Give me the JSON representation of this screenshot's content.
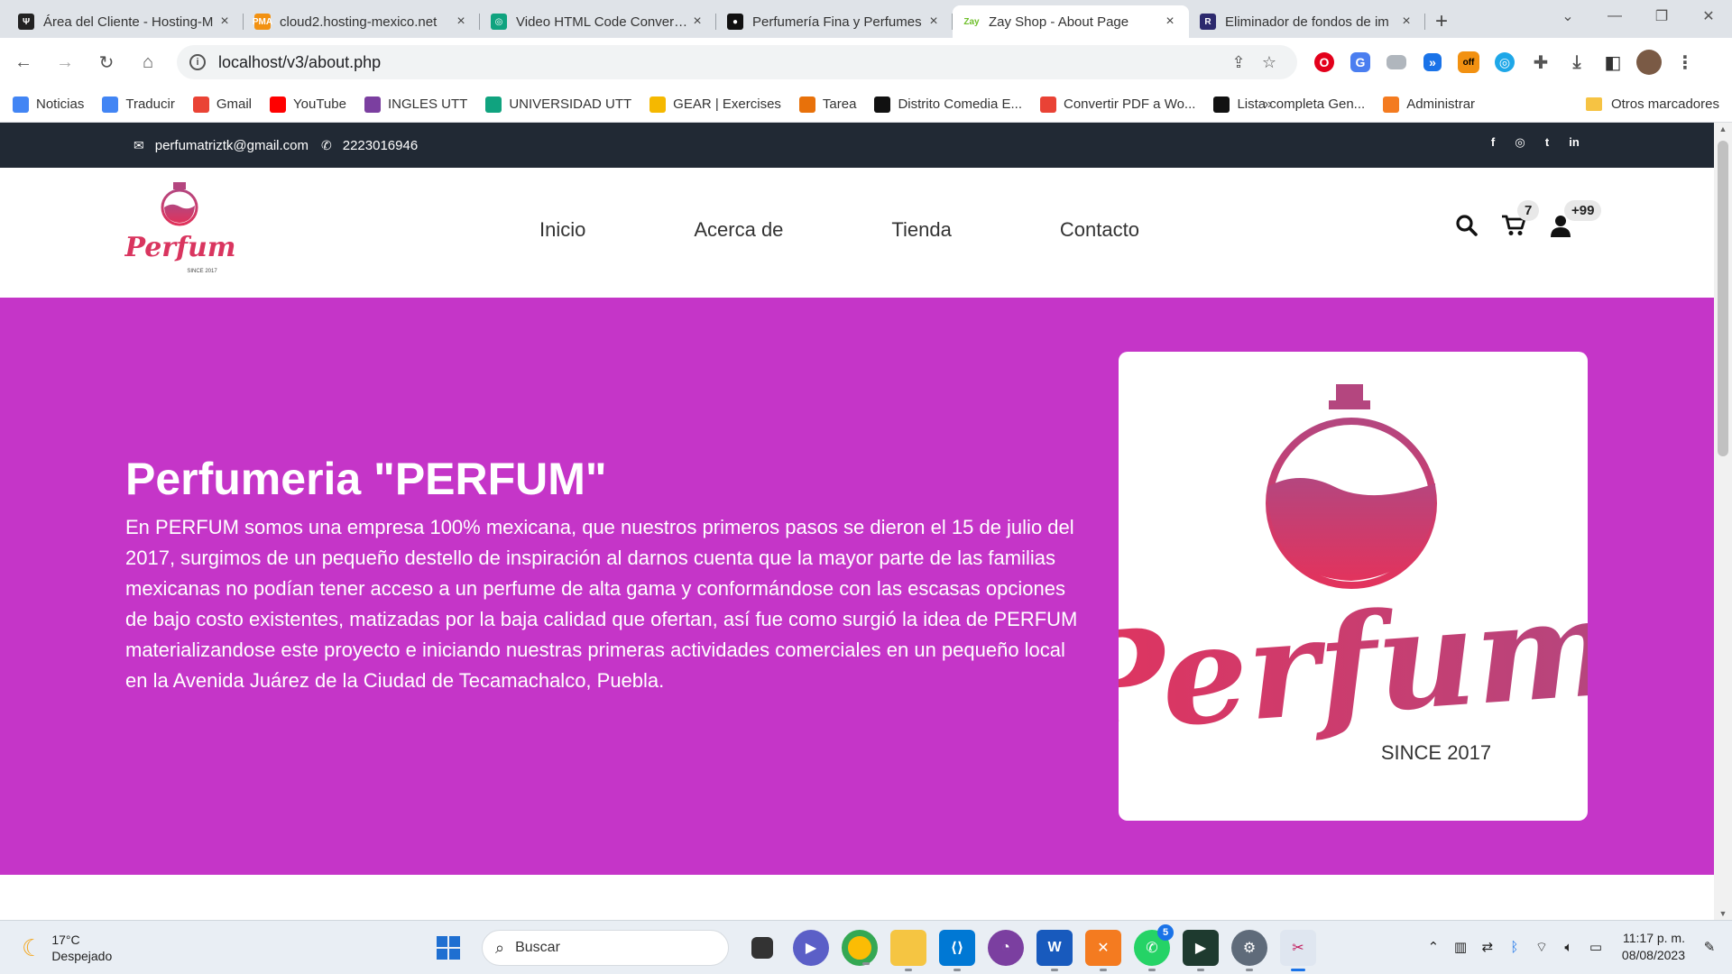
{
  "browser": {
    "tabs": [
      {
        "title": "Área del Cliente - Hosting-M",
        "fav_color": "#222222",
        "fav_glyph": "Ψ"
      },
      {
        "title": "cloud2.hosting-mexico.net",
        "fav_color": "#f29111",
        "fav_glyph": "PMA"
      },
      {
        "title": "Video HTML Code Conversion",
        "fav_color": "#10a37f",
        "fav_glyph": "◎"
      },
      {
        "title": "Perfumería Fina y Perfumes",
        "fav_color": "#111111",
        "fav_glyph": "●"
      },
      {
        "title": "Zay Shop - About Page",
        "fav_color": "#ffffff",
        "fav_glyph": "Zay",
        "active": true
      },
      {
        "title": "Eliminador de fondos de im",
        "fav_color": "#2d2a6e",
        "fav_glyph": "R"
      }
    ],
    "url": "localhost/v3/about.php",
    "bookmarks": [
      {
        "label": "Noticias",
        "color": "#4285f4"
      },
      {
        "label": "Traducir",
        "color": "#4285f4"
      },
      {
        "label": "Gmail",
        "color": "#ea4335"
      },
      {
        "label": "YouTube",
        "color": "#ff0000"
      },
      {
        "label": "INGLES UTT",
        "color": "#7b3fa0"
      },
      {
        "label": "UNIVERSIDAD UTT",
        "color": "#10a37f"
      },
      {
        "label": "GEAR | Exercises",
        "color": "#f5b800"
      },
      {
        "label": "Tarea",
        "color": "#e8710a"
      },
      {
        "label": "Distrito Comedia E...",
        "color": "#111111"
      },
      {
        "label": "Convertir PDF a Wo...",
        "color": "#e94235"
      },
      {
        "label": "Lista completa Gen...",
        "color": "#111111"
      },
      {
        "label": "Administrar",
        "color": "#f47b20"
      }
    ],
    "other_bookmarks": "Otros marcadores",
    "more_glyph": "»"
  },
  "topbar": {
    "email": "perfumatriztk@gmail.com",
    "phone": "2223016946"
  },
  "nav": {
    "links": [
      "Inicio",
      "Acerca de",
      "Tienda",
      "Contacto"
    ],
    "cart_count": "7",
    "user_count": "+99"
  },
  "hero": {
    "title": "Perfumeria \"PERFUM\"",
    "text": "En PERFUM somos una empresa 100% mexicana, que nuestros primeros pasos se dieron el 15 de julio del 2017, surgimos de un pequeño destello de inspiración al darnos cuenta que la mayor parte de las familias mexicanas no podían tener acceso a un perfume de alta gama y conformándose con las escasas opciones de bajo costo existentes, matizadas por la baja calidad que ofertan, así fue como surgió la idea de PERFUM materializandose este proyecto e iniciando nuestras primeras actividades comerciales en un pequeño local en la Avenida Juárez de la Ciudad de Tecamachalco, Puebla.",
    "bg_color": "#c535c8",
    "logo_wordmark": "Perfum",
    "logo_since": "SINCE 2017"
  },
  "taskbar": {
    "weather_temp": "17°C",
    "weather_desc": "Despejado",
    "search_placeholder": "Buscar",
    "whatsapp_badge": "5",
    "time": "11:17 p. m.",
    "date": "08/08/2023"
  }
}
